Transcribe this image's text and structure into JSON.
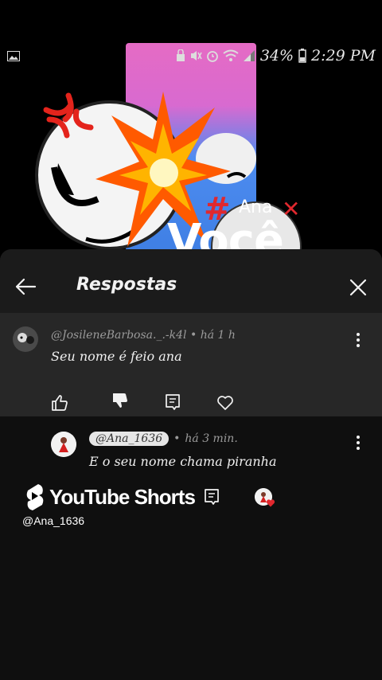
{
  "status_bar": {
    "battery": "34%",
    "time": "2:29 PM"
  },
  "video": {
    "sticker_text_main": "Você",
    "sticker_text_tag": "#",
    "sticker_text_name": "Ana"
  },
  "sheet": {
    "title": "Respostas"
  },
  "parent_comment": {
    "author": "@JosileneBarbosa._.-k4l",
    "time": "há 1 h",
    "text": "Seu nome é feio ana"
  },
  "reply": {
    "author": "@Ana_1636",
    "time": "há 3 min.",
    "text": "E o seu nome chama piranha"
  },
  "watermark": {
    "brand": "YouTube Shorts",
    "handle": "@Ana_1636"
  },
  "colors": {
    "sheet_bg": "#0f0f0f",
    "header_bg": "#1b1b1b",
    "highlight_bg": "#272727",
    "explosion": "#ff6a00",
    "x_mark": "#e0282e"
  }
}
